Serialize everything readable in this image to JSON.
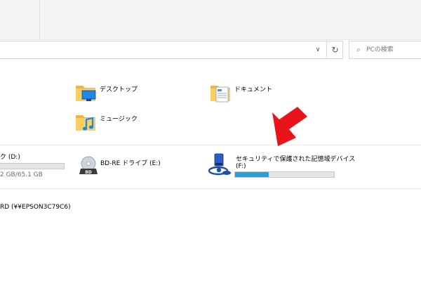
{
  "search": {
    "placeholder": "PCの検索",
    "icon": "search-icon"
  },
  "nav": {
    "dropdown_icon": "chevron-down-icon",
    "refresh_icon": "refresh-icon"
  },
  "folders": [
    {
      "label": "デスクトップ",
      "icon": "desktop-folder-icon"
    },
    {
      "label": "ドキュメント",
      "icon": "documents-folder-icon"
    },
    {
      "label": "ミュージック",
      "icon": "music-folder-icon"
    }
  ],
  "drives": {
    "d": {
      "label": "ク (D:)",
      "space": "2 GB/65.1 GB",
      "icon": "local-disk-icon"
    },
    "e": {
      "label": "BD-RE ドライブ (E:)",
      "badge": "BD",
      "icon": "bd-drive-icon"
    },
    "f": {
      "label": "セキュリティで保護された記憶域デバイス",
      "letter": "(F:)",
      "used_fraction": 0.34,
      "icon": "secure-storage-icon",
      "bar_color": "#26a0da"
    }
  },
  "network": {
    "label": "RD (¥¥EPSON3C79C6)"
  },
  "annotation": {
    "arrow_color": "#e8141a"
  }
}
